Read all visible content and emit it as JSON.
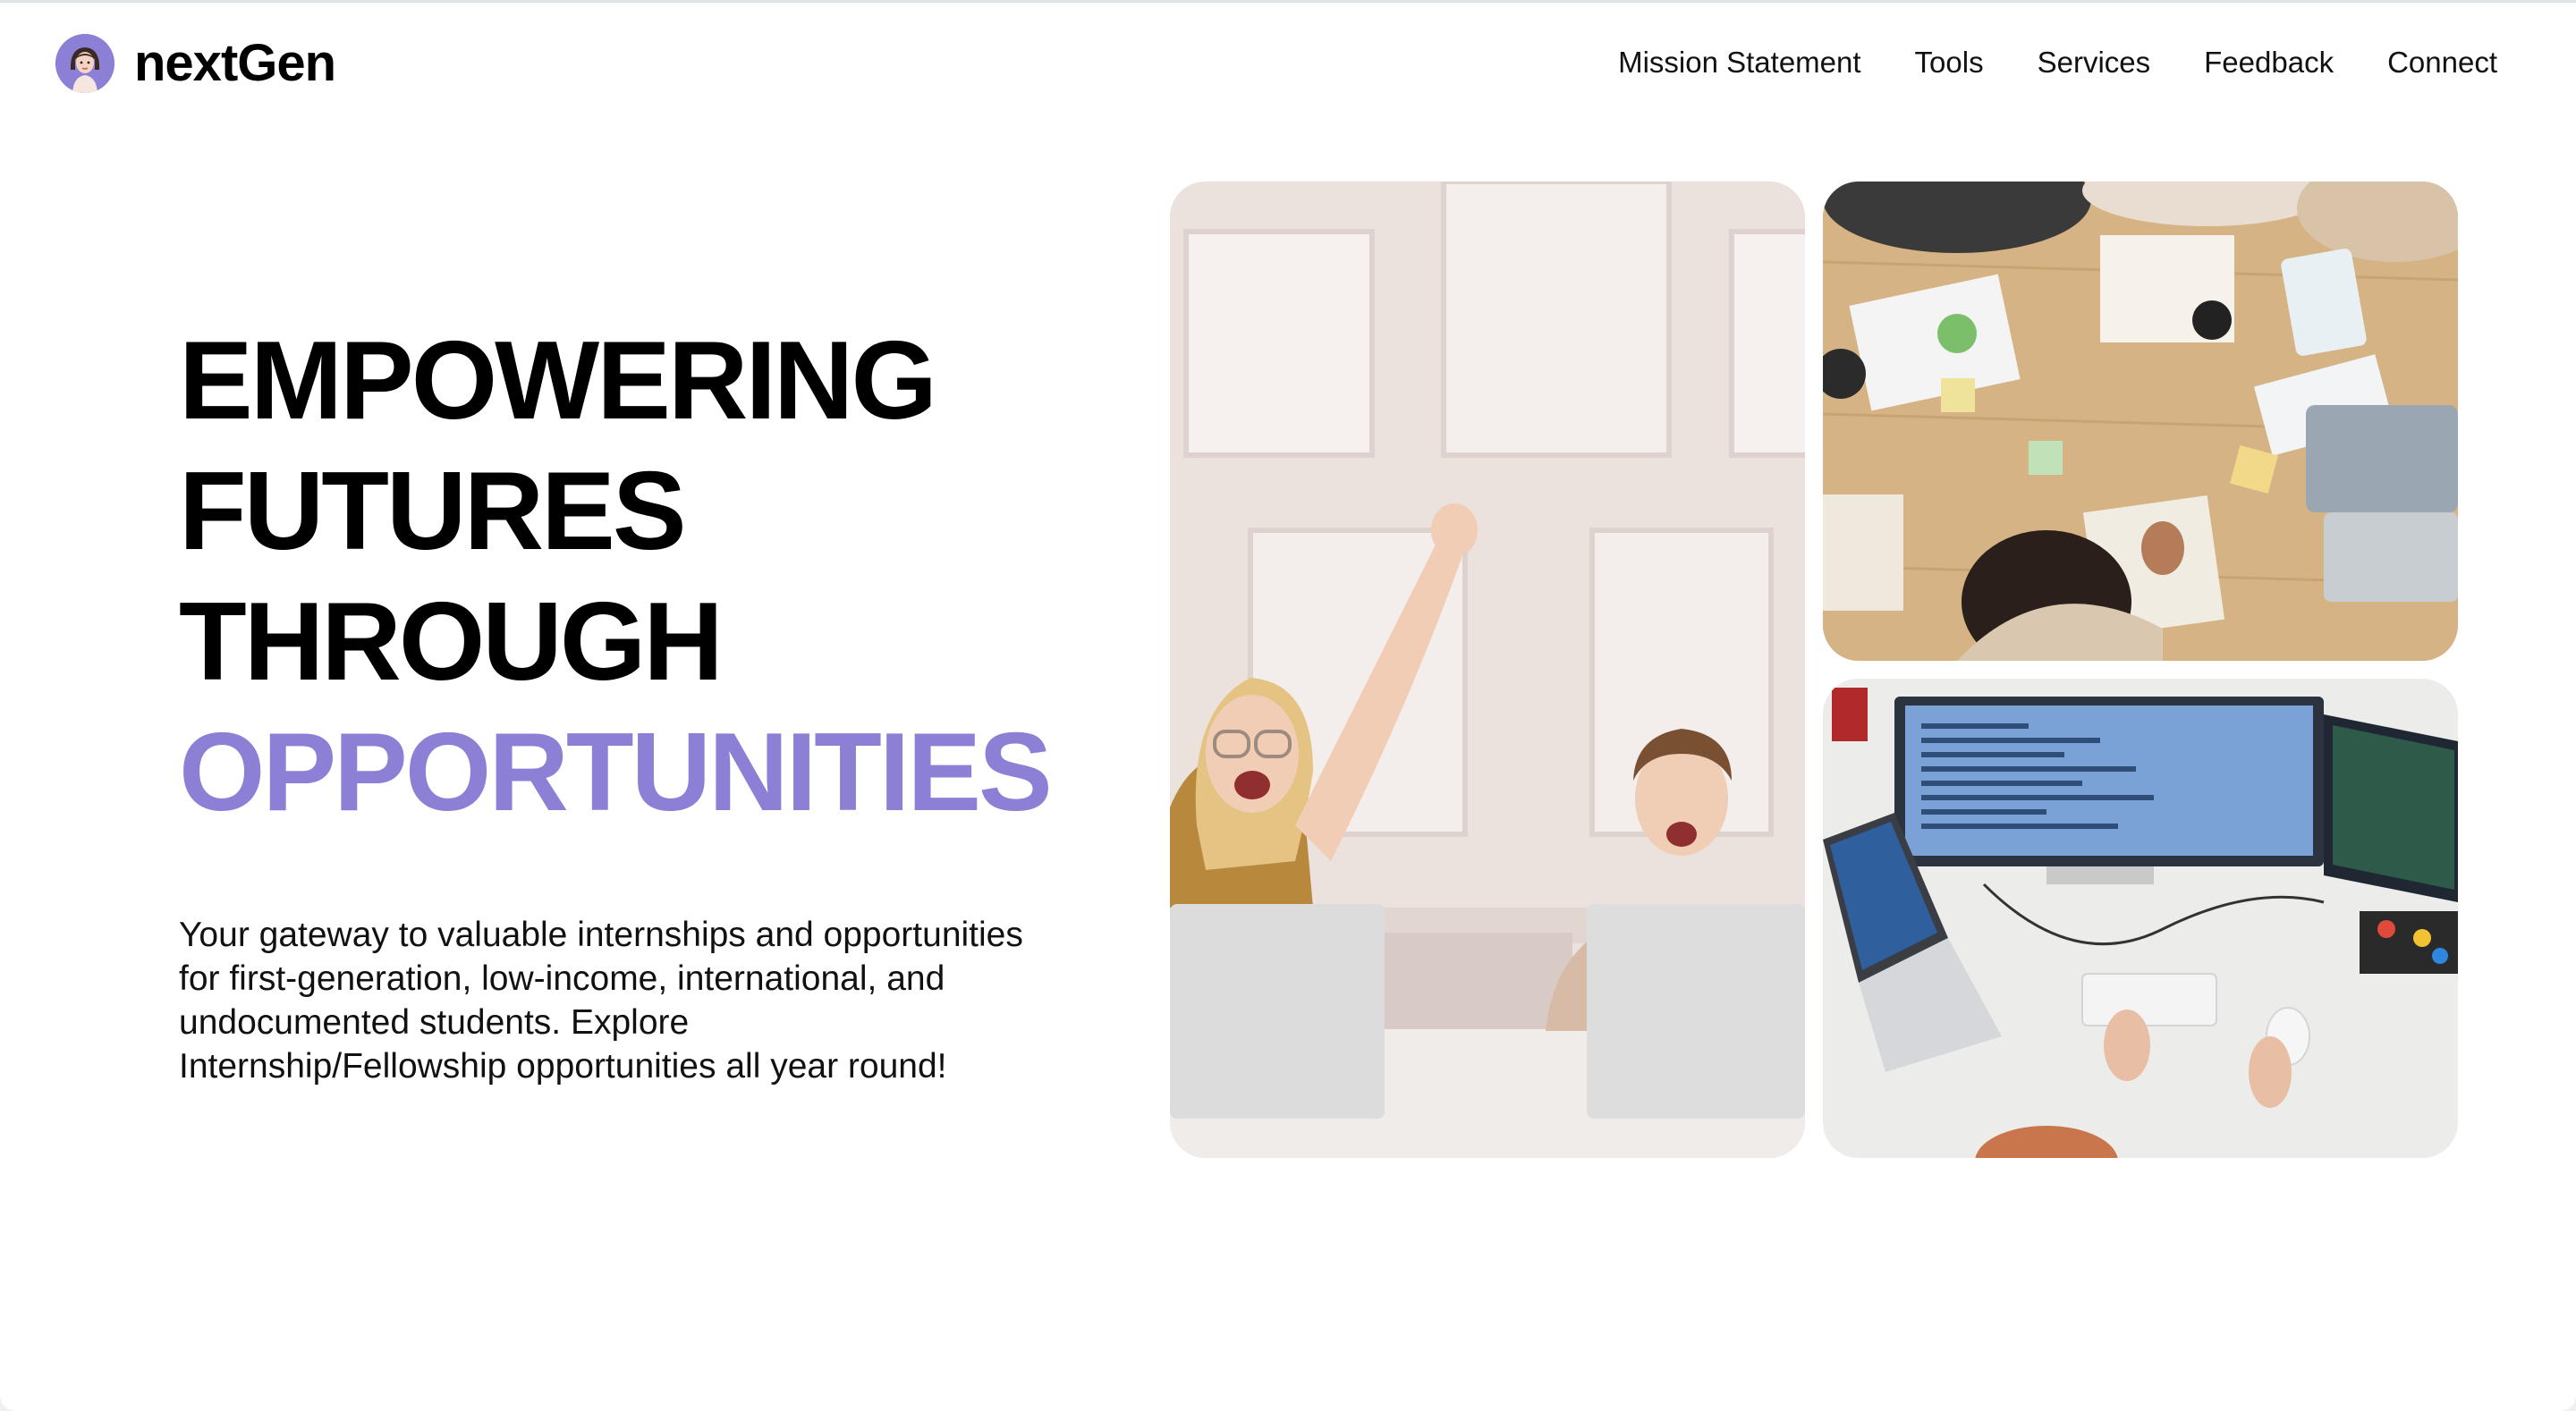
{
  "brand": {
    "name": "nextGen",
    "logo_icon": "girl-avatar-icon"
  },
  "nav": {
    "links": [
      "Mission Statement",
      "Tools",
      "Services",
      "Feedback",
      "Connect"
    ]
  },
  "hero": {
    "headline": [
      "EMPOWERING",
      "FUTURES",
      "THROUGH",
      "OPPORTUNITIES"
    ],
    "tagline_lines": [
      "Your gateway to valuable internships and opportunities",
      "for first-generation, low-income, international, and",
      "undocumented students. Explore",
      "Internship/Fellowship opportunities all year round!"
    ]
  },
  "colors": {
    "accent": "#8b7fd6",
    "text": "#000000",
    "background": "#ffffff"
  },
  "images": [
    {
      "name": "celebrating-students-photo"
    },
    {
      "name": "team-meeting-overhead-photo"
    },
    {
      "name": "coding-workstation-photo"
    }
  ]
}
